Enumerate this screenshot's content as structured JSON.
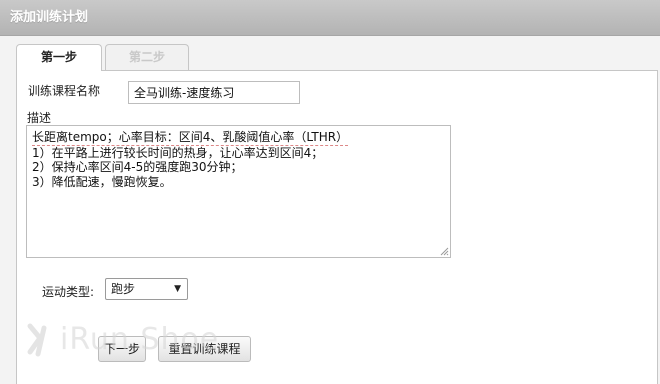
{
  "window": {
    "title": "添加训练计划"
  },
  "tabs": [
    {
      "label": "第一步",
      "active": true
    },
    {
      "label": "第二步",
      "active": false
    }
  ],
  "form": {
    "course_name_label": "训练课程名称",
    "course_name_value": "全马训练-速度练习",
    "description_label": "描述",
    "description_line1": "长距离tempo；心率目标：区间4、乳酸阈值心率（LTHR）",
    "description_rest": "\n1）在平路上进行较长时间的热身，让心率达到区间4；\n2）保持心率区间4-5的强度跑30分钟；\n3）降低配速，慢跑恢复。",
    "sport_type_label": "运动类型:",
    "sport_type_value": "跑步"
  },
  "buttons": {
    "next_label": "下一步",
    "reset_label": "重置训练课程"
  },
  "watermark": {
    "text": "iRun Shoe"
  },
  "colors": {
    "title_bar": "#b9b9b9",
    "panel_border": "#c6c6c6",
    "inactive_tab_text": "#c9c9c9"
  }
}
